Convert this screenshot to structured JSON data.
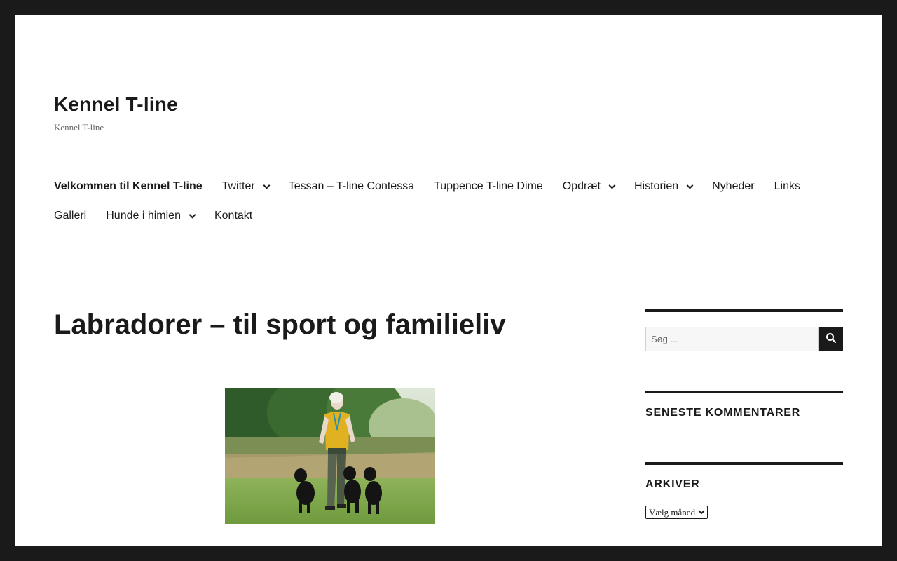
{
  "site": {
    "title": "Kennel T-line",
    "description": "Kennel T-line"
  },
  "nav": {
    "row1": [
      {
        "label": "Velkommen til Kennel T-line",
        "current": true,
        "has_submenu": false
      },
      {
        "label": "Twitter",
        "current": false,
        "has_submenu": true
      },
      {
        "label": "Tessan – T-line Contessa",
        "current": false,
        "has_submenu": false
      },
      {
        "label": "Tuppence T-line Dime",
        "current": false,
        "has_submenu": false
      },
      {
        "label": "Opdræt",
        "current": false,
        "has_submenu": true
      },
      {
        "label": "Historien",
        "current": false,
        "has_submenu": true
      },
      {
        "label": "Nyheder",
        "current": false,
        "has_submenu": false
      },
      {
        "label": "Links",
        "current": false,
        "has_submenu": false
      }
    ],
    "row2": [
      {
        "label": "Galleri",
        "current": false,
        "has_submenu": false
      },
      {
        "label": "Hunde i himlen",
        "current": false,
        "has_submenu": true
      },
      {
        "label": "Kontakt",
        "current": false,
        "has_submenu": false
      }
    ]
  },
  "main": {
    "entry_title": "Labradorer – til sport og familieliv",
    "image_icon": "photo-woman-with-three-black-labradors"
  },
  "sidebar": {
    "search": {
      "placeholder": "Søg …",
      "button_icon": "search-icon"
    },
    "recent_comments": {
      "title": "SENESTE KOMMENTARER"
    },
    "archives": {
      "title": "ARKIVER",
      "select_value": "Vælg måned"
    }
  },
  "colors": {
    "frame": "#1a1a1a",
    "page": "#ffffff",
    "text": "#1a1a1a",
    "muted": "#686868"
  }
}
